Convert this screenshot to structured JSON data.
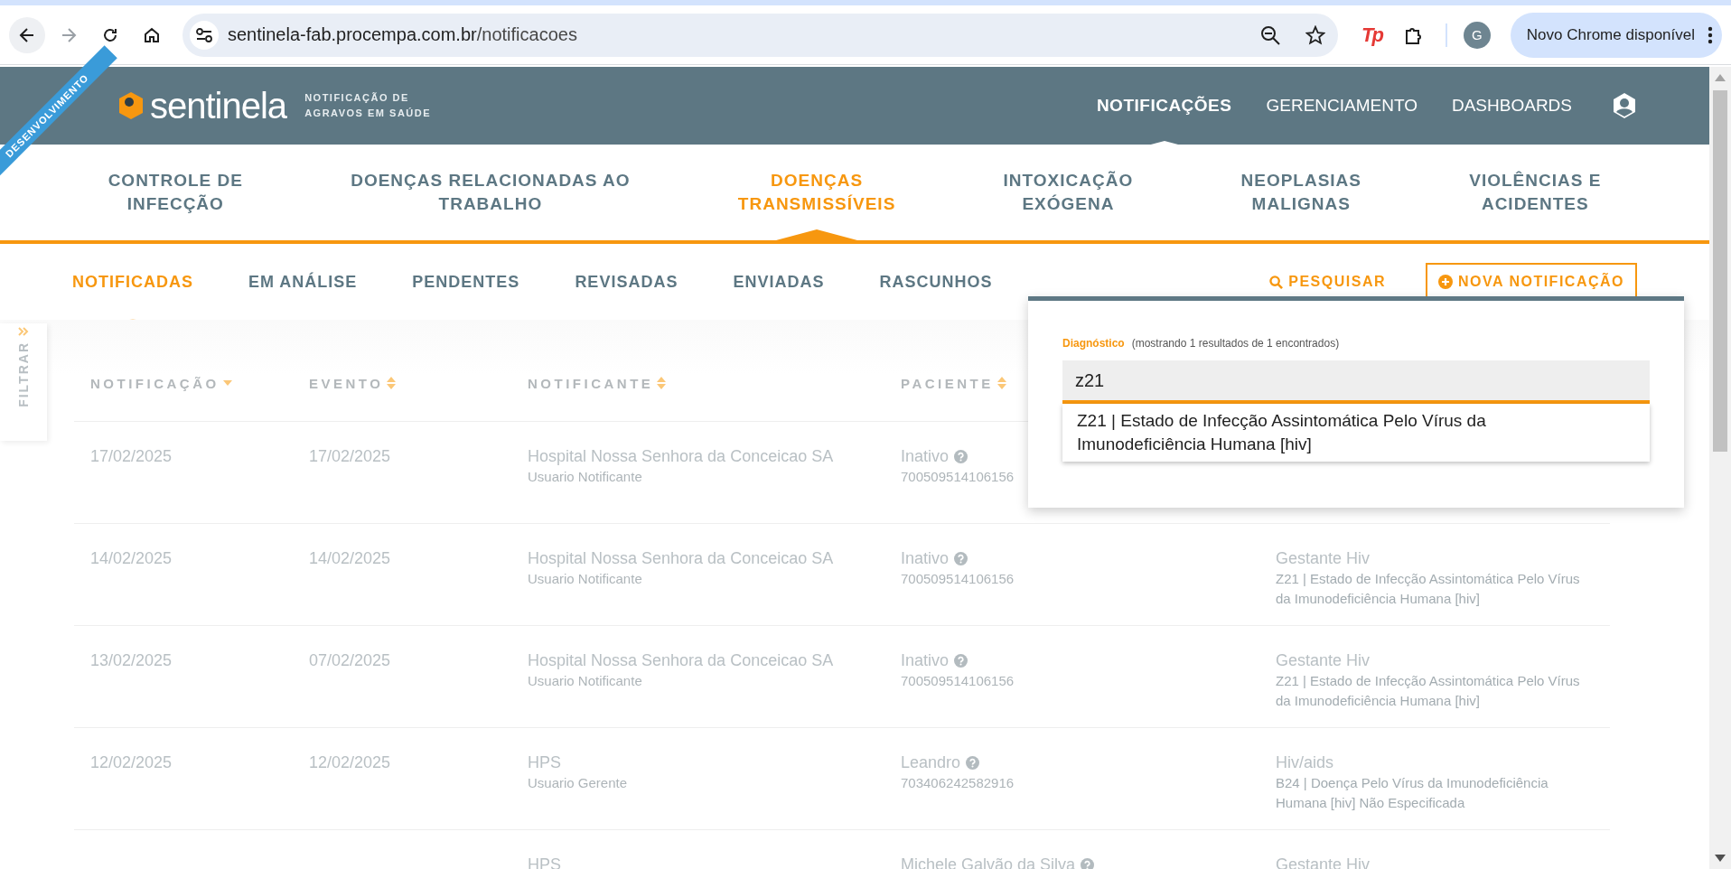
{
  "browser": {
    "url_host": "sentinela-fab.procempa.com.br",
    "url_path": "/notificacoes",
    "extension_label": "Tp",
    "profile_initial": "G",
    "update_button": "Novo Chrome disponível"
  },
  "header": {
    "ribbon": "DESENVOLVIMENTO",
    "logo": "sentinela",
    "tagline": [
      "NOTIFICAÇÃO DE",
      "AGRAVOS EM SAÚDE"
    ],
    "nav": [
      {
        "label": "NOTIFICAÇÕES",
        "selected": true
      },
      {
        "label": "GERENCIAMENTO",
        "selected": false
      },
      {
        "label": "DASHBOARDS",
        "selected": false
      }
    ]
  },
  "categories": [
    {
      "lines": [
        "CONTROLE DE",
        "INFECÇÃO"
      ],
      "selected": false
    },
    {
      "lines": [
        "DOENÇAS RELACIONADAS AO",
        "TRABALHO"
      ],
      "selected": false
    },
    {
      "lines": [
        "DOENÇAS",
        "TRANSMISSÍVEIS"
      ],
      "selected": true
    },
    {
      "lines": [
        "INTOXICAÇÃO",
        "EXÓGENA"
      ],
      "selected": false
    },
    {
      "lines": [
        "NEOPLASIAS",
        "MALIGNAS"
      ],
      "selected": false
    },
    {
      "lines": [
        "VIOLÊNCIAS E",
        "ACIDENTES"
      ],
      "selected": false
    }
  ],
  "subtabs": [
    {
      "label": "NOTIFICADAS",
      "selected": true
    },
    {
      "label": "EM ANÁLISE",
      "selected": false
    },
    {
      "label": "PENDENTES",
      "selected": false
    },
    {
      "label": "REVISADAS",
      "selected": false
    },
    {
      "label": "ENVIADAS",
      "selected": false
    },
    {
      "label": "RASCUNHOS",
      "selected": false
    }
  ],
  "actions": {
    "search": "PESQUISAR",
    "new": "NOVA NOTIFICAÇÃO"
  },
  "filter_tab": "FILTRAR",
  "table": {
    "columns": [
      {
        "label": "NOTIFICAÇÃO",
        "sorted": true
      },
      {
        "label": "EVENTO",
        "sorted": false
      },
      {
        "label": "NOTIFICANTE",
        "sorted": false
      },
      {
        "label": "PACIENTE",
        "sorted": false
      }
    ],
    "rows": [
      {
        "notificacao": "17/02/2025",
        "evento": "17/02/2025",
        "notificante": "Hospital Nossa Senhora da Conceicao SA",
        "role": "Usuario Notificante",
        "paciente": "Inativo",
        "paciente_id": "700509514106156"
      },
      {
        "notificacao": "14/02/2025",
        "evento": "14/02/2025",
        "notificante": "Hospital Nossa Senhora da Conceicao SA",
        "role": "Usuario Notificante",
        "paciente": "Inativo",
        "paciente_id": "700509514106156",
        "agravo": "Gestante Hiv",
        "diagnostico": "Z21 | Estado de Infecção Assintomática Pelo Vírus da Imunodeficiência Humana [hiv]"
      },
      {
        "notificacao": "13/02/2025",
        "evento": "07/02/2025",
        "notificante": "Hospital Nossa Senhora da Conceicao SA",
        "role": "Usuario Notificante",
        "paciente": "Inativo",
        "paciente_id": "700509514106156",
        "agravo": "Gestante Hiv",
        "diagnostico": "Z21 | Estado de Infecção Assintomática Pelo Vírus da Imunodeficiência Humana [hiv]"
      },
      {
        "notificacao": "12/02/2025",
        "evento": "12/02/2025",
        "notificante": "HPS",
        "role": "Usuario Gerente",
        "paciente": "Leandro",
        "paciente_id": "703406242582916",
        "agravo": "Hiv/aids",
        "diagnostico": "B24 | Doença Pelo Vírus da Imunodeficiência Humana [hiv] Não Especificada"
      },
      {
        "notificante": "HPS",
        "paciente": "Michele Galvão da Silva",
        "agravo": "Gestante Hiv"
      }
    ]
  },
  "popup": {
    "label": "Diagnóstico",
    "count": "(mostrando 1 resultados de 1 encontrados)",
    "value": "z21",
    "suggestions": [
      "Z21 | Estado de Infecção Assintomática Pelo Vírus da Imunodeficiência Humana [hiv]"
    ]
  }
}
